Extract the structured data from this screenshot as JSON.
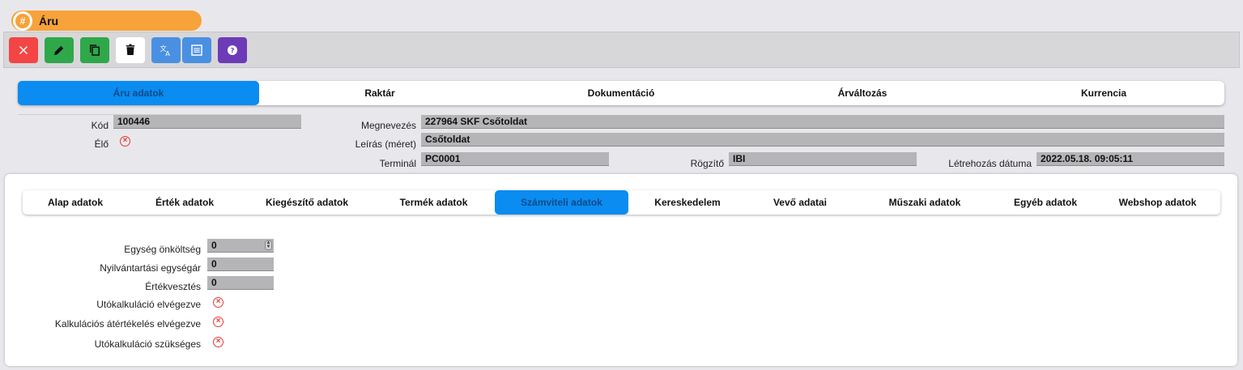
{
  "window": {
    "title": "Áru",
    "badge": "#"
  },
  "toolbar": {
    "buttons": [
      {
        "name": "close",
        "icon": "close-icon"
      },
      {
        "name": "edit",
        "icon": "pencil-icon"
      },
      {
        "name": "copy",
        "icon": "copy-icon"
      },
      {
        "name": "delete",
        "icon": "trash-icon"
      },
      {
        "name": "translate",
        "icon": "translate-icon"
      },
      {
        "name": "list",
        "icon": "list-icon"
      },
      {
        "name": "help",
        "icon": "help-icon"
      }
    ]
  },
  "top_tabs": [
    "Áru adatok",
    "Raktár",
    "Dokumentáció",
    "Árváltozás",
    "Kurrencia"
  ],
  "top_tab_active": 0,
  "header": {
    "kod_label": "Kód",
    "kod_value": "100446",
    "elo_label": "Élő",
    "megnevezes_label": "Megnevezés",
    "megnevezes_value": "227964 SKF Csőtoldat",
    "leiras_label": "Leírás (méret)",
    "leiras_value": "Csőtoldat",
    "terminal_label": "Terminál",
    "terminal_value": "PC0001",
    "rogzito_label": "Rögzítő",
    "rogzito_value": "IBI",
    "letrehozas_label": "Létrehozás dátuma",
    "letrehozas_value": "2022.05.18. 09:05:11"
  },
  "sub_tabs": [
    "Alap adatok",
    "Érték adatok",
    "Kiegészítő adatok",
    "Termék adatok",
    "Számviteli adatok",
    "Kereskedelem",
    "Vevő adatai",
    "Műszaki adatok",
    "Egyéb adatok",
    "Webshop adatok"
  ],
  "sub_tab_active": 4,
  "form": {
    "egyseg_label": "Egység önköltség",
    "egyseg_value": "0",
    "nyilv_label": "Nyilvántartási egységár",
    "nyilv_value": "0",
    "ertekv_label": "Értékvesztés",
    "ertekv_value": "0",
    "utokalk_label": "Utókalkuláció elvégezve",
    "kalkat_label": "Kalkulációs átértékelés elvégezve",
    "utoszuks_label": "Utókalkuláció szükséges"
  },
  "colors": {
    "accent": "#0a8cf0",
    "title": "#f7a23a",
    "error": "#e53935"
  }
}
